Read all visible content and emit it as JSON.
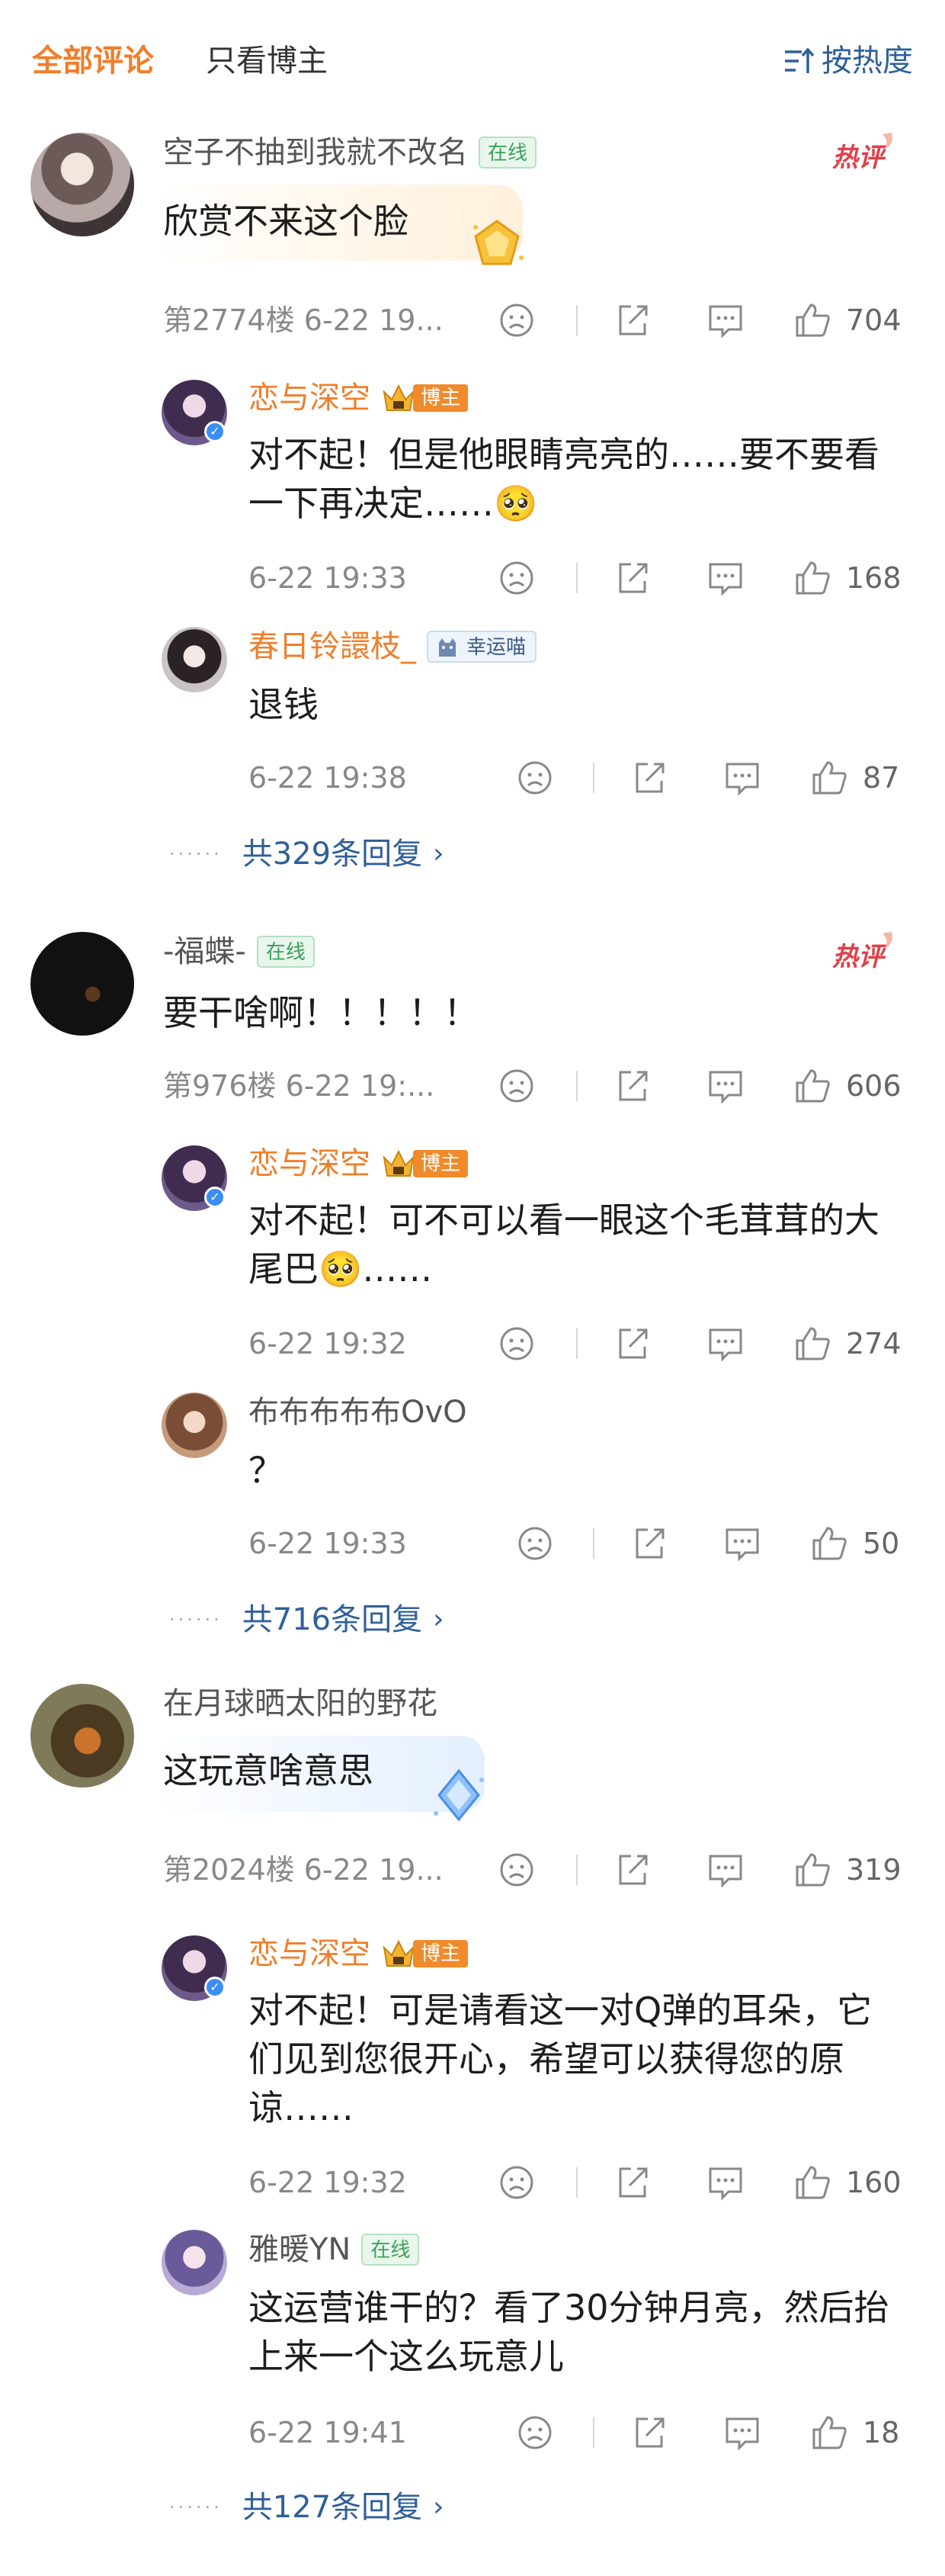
{
  "tabs": {
    "all": "全部评论",
    "blogger": "只看博主"
  },
  "sort": {
    "label": "按热度"
  },
  "badges": {
    "online": "在线",
    "host": "博主",
    "lucky": "幸运喵"
  },
  "colors": {
    "accent": "#f07e2a",
    "link": "#2f5f9a",
    "hot": "#e0404a"
  },
  "threads": [
    {
      "user": "空子不抽到我就不改名",
      "text": "欣赏不来这个脸",
      "floor": "第2774楼 6-22 19...",
      "likes": "704",
      "reply1": {
        "user": "恋与深空",
        "text": "对不起！但是他眼睛亮亮的……要不要看一下再决定……🥺",
        "time": "6-22 19:33",
        "likes": "168"
      },
      "reply2": {
        "user": "春日铃譞枝_",
        "text": "退钱",
        "time": "6-22 19:38",
        "likes": "87"
      },
      "more": "共329条回复"
    },
    {
      "user": "-福蝶-",
      "text": "要干啥啊！！！！！",
      "floor": "第976楼 6-22 19:...",
      "likes": "606",
      "reply1": {
        "user": "恋与深空",
        "text": "对不起！可不可以看一眼这个毛茸茸的大尾巴🥺……",
        "time": "6-22 19:32",
        "likes": "274"
      },
      "reply2": {
        "user": "布布布布布OvO",
        "text": "？",
        "time": "6-22 19:33",
        "likes": "50"
      },
      "more": "共716条回复"
    },
    {
      "user": "在月球晒太阳的野花",
      "text": "这玩意啥意思",
      "floor": "第2024楼 6-22 19...",
      "likes": "319",
      "reply1": {
        "user": "恋与深空",
        "text": "对不起！可是请看这一对Q弹的耳朵，它们见到您很开心，希望可以获得您的原谅……",
        "time": "6-22 19:32",
        "likes": "160"
      },
      "reply2": {
        "user": "雅暖YN",
        "text": "这运营谁干的？看了30分钟月亮，然后抬上来一个这么玩意儿",
        "time": "6-22 19:41",
        "likes": "18"
      },
      "more": "共127条回复"
    }
  ]
}
